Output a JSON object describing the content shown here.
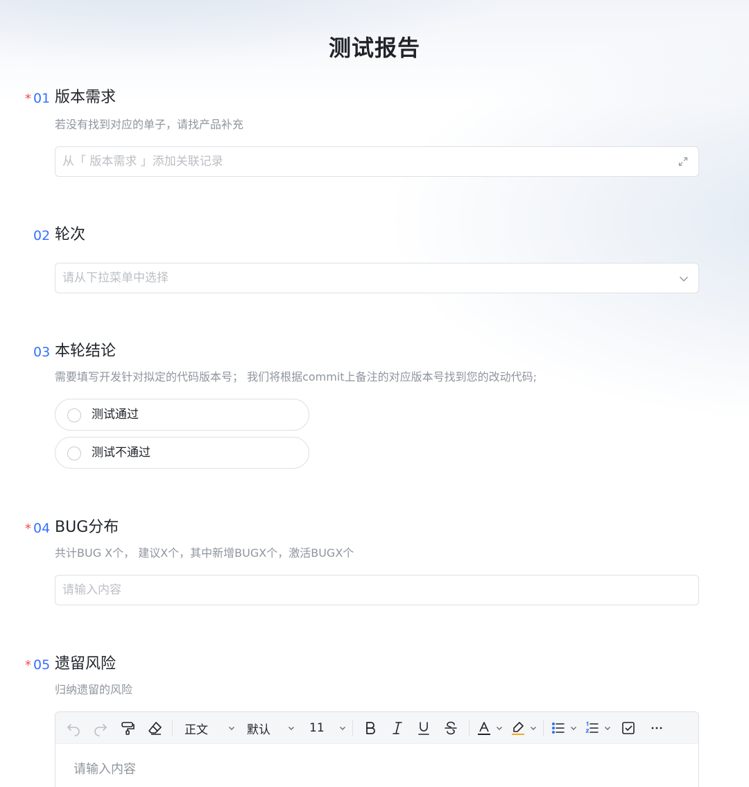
{
  "form": {
    "title": "测试报告"
  },
  "questions": [
    {
      "number": "01",
      "required": "*",
      "label": "版本需求",
      "description": "若没有找到对应的单子，请找产品补充",
      "placeholder": "从「 版本需求 」添加关联记录",
      "icon": "expand-icon"
    },
    {
      "number": "02",
      "label": "轮次",
      "placeholder": "请从下拉菜单中选择",
      "icon": "chevron-down-icon"
    },
    {
      "number": "03",
      "label": "本轮结论",
      "description": "需要填写开发针对拟定的代码版本号；  我们将根据commit上备注的对应版本号找到您的改动代码;",
      "options": [
        "测试通过",
        "测试不通过"
      ]
    },
    {
      "number": "04",
      "required": "*",
      "label": "BUG分布",
      "description": "共计BUG X个，  建议X个，其中新增BUGX个，激活BUGX个",
      "placeholder": "请输入内容"
    },
    {
      "number": "05",
      "required": "*",
      "label": "遗留风险",
      "description": "归纳遗留的风险",
      "placeholder": "请输入内容"
    }
  ],
  "editor_toolbar": {
    "paragraph_style": "正文",
    "font": "默认",
    "font_size": "11",
    "icons": [
      "undo-icon",
      "redo-icon",
      "format-painter-icon",
      "clear-format-icon",
      "bold-icon",
      "italic-icon",
      "underline-icon",
      "strikethrough-icon",
      "font-color-icon",
      "highlight-icon",
      "bullet-list-icon",
      "numbered-list-icon",
      "checklist-icon",
      "more-icon"
    ],
    "highlight_color": "#f5a623",
    "accent_color": "#3370ff",
    "required_color": "#f54a45"
  }
}
